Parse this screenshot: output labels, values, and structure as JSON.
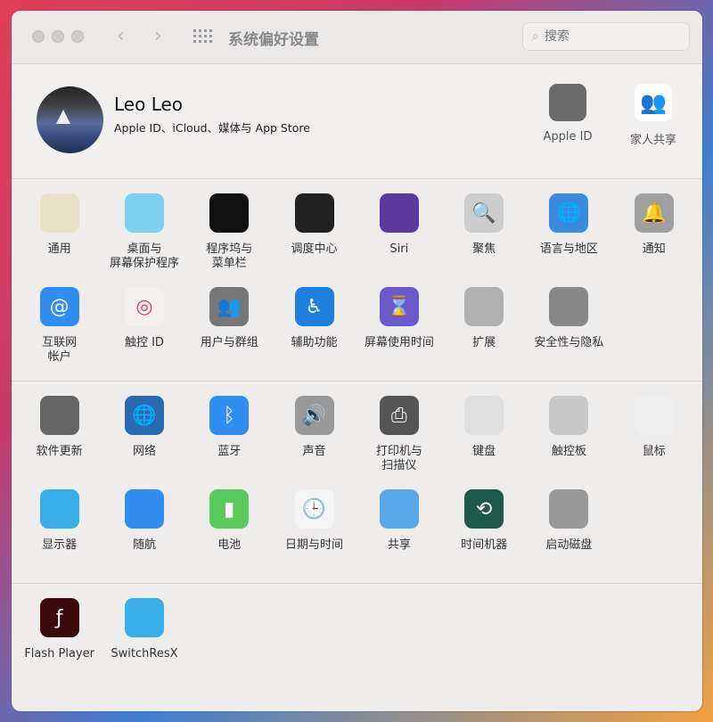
{
  "window": {
    "title": "系统偏好设置",
    "search_placeholder": "搜索"
  },
  "profile": {
    "name": "Leo Leo",
    "subtitle": "Apple ID、iCloud、媒体与 App Store",
    "apple_id_label": "Apple ID",
    "family_label": "家人共享"
  },
  "sections": [
    [
      {
        "label": "通用",
        "icon": "general-icon",
        "color": "#e8e2c8"
      },
      {
        "label": "桌面与\n屏幕保护程序",
        "icon": "desktop-icon",
        "color": "#7fd0f0"
      },
      {
        "label": "程序坞与\n菜单栏",
        "icon": "dock-icon",
        "color": "#111111"
      },
      {
        "label": "调度中心",
        "icon": "mission-control-icon",
        "color": "#222222"
      },
      {
        "label": "Siri",
        "icon": "siri-icon",
        "color": "#5a3a9a"
      },
      {
        "label": "聚焦",
        "icon": "spotlight-icon",
        "color": "#cccccc"
      },
      {
        "label": "语言与地区",
        "icon": "language-icon",
        "color": "#3a8ae0"
      },
      {
        "label": "通知",
        "icon": "notification-bell-icon",
        "color": "#a0a0a0"
      },
      {
        "label": "互联网\n帐户",
        "icon": "internet-accounts-icon",
        "color": "#2f8ef0"
      },
      {
        "label": "触控 ID",
        "icon": "touch-id-icon",
        "color": "#f5f0f0"
      },
      {
        "label": "用户与群组",
        "icon": "users-groups-icon",
        "color": "#777777"
      },
      {
        "label": "辅助功能",
        "icon": "accessibility-icon",
        "color": "#1e7fe0"
      },
      {
        "label": "屏幕使用时间",
        "icon": "screen-time-icon",
        "color": "#6a5acd"
      },
      {
        "label": "扩展",
        "icon": "extensions-icon",
        "color": "#b0b0b0"
      },
      {
        "label": "安全性与隐私",
        "icon": "security-icon",
        "color": "#888888"
      }
    ],
    [
      {
        "label": "软件更新",
        "icon": "software-update-icon",
        "color": "#666666"
      },
      {
        "label": "网络",
        "icon": "network-icon",
        "color": "#2a6ab0"
      },
      {
        "label": "蓝牙",
        "icon": "bluetooth-icon",
        "color": "#2f8ef0"
      },
      {
        "label": "声音",
        "icon": "sound-icon",
        "color": "#999999"
      },
      {
        "label": "打印机与\n扫描仪",
        "icon": "printer-icon",
        "color": "#555555"
      },
      {
        "label": "键盘",
        "icon": "keyboard-icon",
        "color": "#e0e0e0"
      },
      {
        "label": "触控板",
        "icon": "trackpad-icon",
        "color": "#c8c8c8"
      },
      {
        "label": "鼠标",
        "icon": "mouse-icon",
        "color": "#f0f0f0"
      },
      {
        "label": "显示器",
        "icon": "display-icon",
        "color": "#3aaee8"
      },
      {
        "label": "随航",
        "icon": "sidecar-icon",
        "color": "#2f8ef0"
      },
      {
        "label": "电池",
        "icon": "battery-icon",
        "color": "#5ac85a"
      },
      {
        "label": "日期与时间",
        "icon": "clock-icon",
        "color": "#f5f5f5"
      },
      {
        "label": "共享",
        "icon": "sharing-folder-icon",
        "color": "#5aa8e8"
      },
      {
        "label": "时间机器",
        "icon": "time-machine-icon",
        "color": "#1e5a4a"
      },
      {
        "label": "启动磁盘",
        "icon": "startup-disk-icon",
        "color": "#999999"
      }
    ],
    [
      {
        "label": "Flash Player",
        "icon": "flash-player-icon",
        "color": "#3a0a0a"
      },
      {
        "label": "SwitchResX",
        "icon": "switchresx-icon",
        "color": "#3aaee8"
      }
    ]
  ]
}
